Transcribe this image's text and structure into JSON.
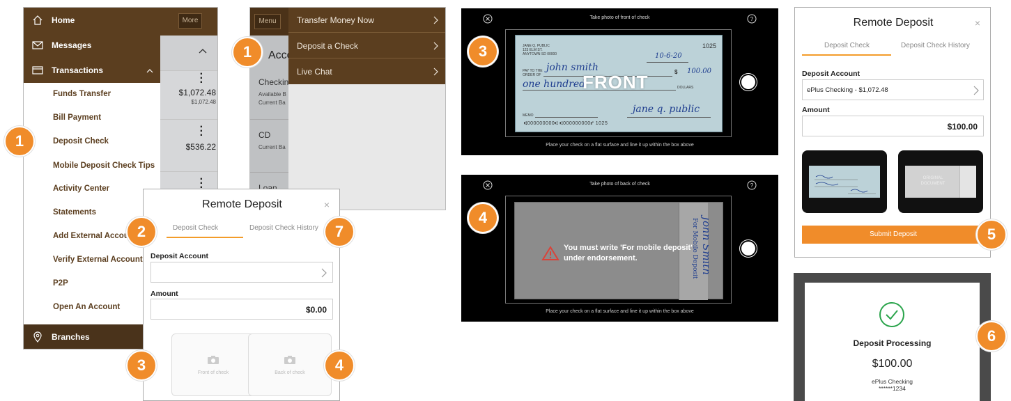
{
  "colors": {
    "brand_brown": "#5b3e1f",
    "accent_orange": "#f08c2a",
    "check_blue": "#bcd2d8"
  },
  "side_menu": {
    "items": [
      {
        "label": "Home",
        "icon": "home-icon"
      },
      {
        "label": "Messages",
        "icon": "mail-icon"
      },
      {
        "label": "Transactions",
        "icon": "card-icon"
      }
    ],
    "sub_items": [
      "Funds Transfer",
      "Bill Payment",
      "Deposit Check",
      "Mobile Deposit Check Tips",
      "Activity Center",
      "Statements",
      "Add External Accoun",
      "Verify External Account",
      "P2P",
      "Open An Account"
    ],
    "branches": {
      "label": "Branches",
      "icon": "location-pin-icon"
    },
    "more_label": "More",
    "accounts": [
      {
        "amount": "$1,072.48",
        "sub": "$1,072.48"
      },
      {
        "amount": "$536.22",
        "sub": ""
      }
    ]
  },
  "quick_menu": {
    "menu_label": "Menu",
    "items": [
      "Transfer Money Now",
      "Deposit a Check",
      "Live Chat"
    ],
    "accounts_heading": "Accou",
    "left_lines": [
      "Checkin",
      "Available B",
      "Current Ba",
      "CD",
      "Current Ba",
      "Loan"
    ]
  },
  "deposit_form": {
    "title": "Remote Deposit",
    "close": "×",
    "tabs": [
      "Deposit Check",
      "Deposit Check History"
    ],
    "account_label": "Deposit Account",
    "account_value": "",
    "amount_label": "Amount",
    "amount_value": "$0.00",
    "front_label": "Front of check",
    "back_label": "Back of check"
  },
  "camera_front": {
    "title": "Take photo of front of check",
    "hint": "Place your check on a flat surface and line it up within the box above",
    "overlay_label": "FRONT",
    "check": {
      "name": "JANE Q. PUBLIC",
      "address1": "123 ELM ST.",
      "address2": "ANYTOWN SD 00000",
      "number": "1025",
      "date": "10-6-20",
      "payee_label": "PAY TO THE ORDER OF",
      "payee": "john smith",
      "amount": "100.00",
      "words": "one hundred",
      "dollars": "DOLLARS",
      "memo": "MEMO",
      "signature": "jane q. public",
      "micr": "⑆000000000⑆ ⑆000000000⑈ 1025"
    }
  },
  "camera_back": {
    "title": "Take photo of back of check",
    "hint": "Place your check on a flat surface and line it up within the box above",
    "warning": "You must write 'For mobile deposit' under endorsement.",
    "endorse_name": "John Smith",
    "endorse_note": "For Mobile Deposit"
  },
  "deposit_filled": {
    "title": "Remote Deposit",
    "close": "×",
    "tabs": [
      "Deposit Check",
      "Deposit Check History"
    ],
    "account_label": "Deposit Account",
    "account_value": "ePlus Checking - $1,072.48",
    "amount_label": "Amount",
    "amount_value": "$100.00",
    "back_thumb_text": "ORIGINAL DOCUMENT",
    "submit_label": "Submit Deposit"
  },
  "processing": {
    "title": "Deposit Processing",
    "amount": "$100.00",
    "account": "ePlus Checking",
    "masked": "******1234"
  },
  "badges": {
    "b1a": "1",
    "b1b": "1",
    "b2": "2",
    "b3a": "3",
    "b3b": "3",
    "b4a": "4",
    "b4b": "4",
    "b5": "5",
    "b6": "6",
    "b7": "7"
  }
}
